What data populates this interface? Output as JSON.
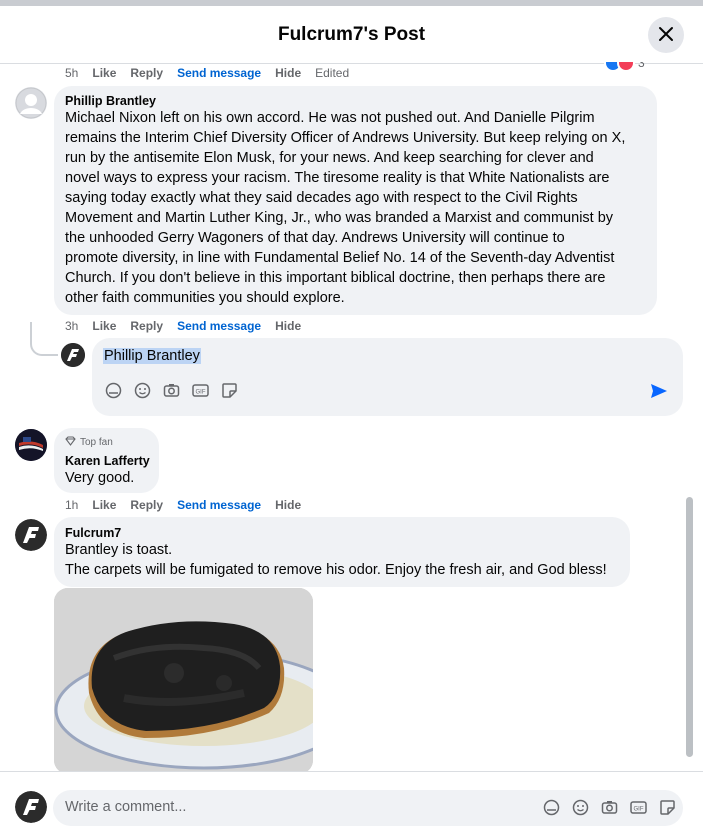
{
  "header": {
    "title": "Fulcrum7's Post",
    "close_icon": "close-icon"
  },
  "comments": [
    {
      "meta": {
        "time": "5h",
        "like": "Like",
        "reply": "Reply",
        "send": "Send message",
        "hide": "Hide",
        "edited": "Edited"
      }
    },
    {
      "author": "Phillip Brantley",
      "lines": [
        "Michael Nixon left on his own accord. He was not pushed out. And Danielle Pilgrim",
        "remains the Interim Chief Diversity Officer of Andrews University. But keep relying on X,",
        "run by the antisemite Elon Musk, for your news. And keep searching for clever and",
        "novel ways to express your racism. The tiresome reality is that White Nationalists are",
        "saying today exactly what they said decades ago with respect to the Civil Rights",
        "Movement and Martin Luther King, Jr., who was branded a Marxist and communist by",
        "the unhooded Gerry Wagoners of that day. Andrews University will continue to",
        "promote diversity, in line with Fundamental Belief No. 14 of the Seventh-day Adventist",
        "Church. If you don't believe in this important biblical doctrine, then perhaps there are",
        "other faith communities you should explore."
      ],
      "meta": {
        "time": "3h",
        "like": "Like",
        "reply": "Reply",
        "send": "Send message",
        "hide": "Hide"
      }
    },
    {
      "badge": "Top fan",
      "author": "Karen Lafferty",
      "text": "Very good.",
      "meta": {
        "time": "1h",
        "like": "Like",
        "reply": "Reply",
        "send": "Send message",
        "hide": "Hide"
      }
    },
    {
      "author": "Fulcrum7",
      "lines": [
        "Brantley is toast.",
        "The carpets will be fumigated to remove his odor. Enjoy the fresh air, and God bless!"
      ]
    }
  ],
  "reply_box": {
    "value": "Phillip Brantley"
  },
  "reactions": {
    "count": "3"
  },
  "footer": {
    "placeholder": "Write a comment..."
  },
  "colors": {
    "link": "#0064d1",
    "bubble": "#f0f2f5",
    "muted": "#65676b",
    "send": "#0866ff"
  }
}
